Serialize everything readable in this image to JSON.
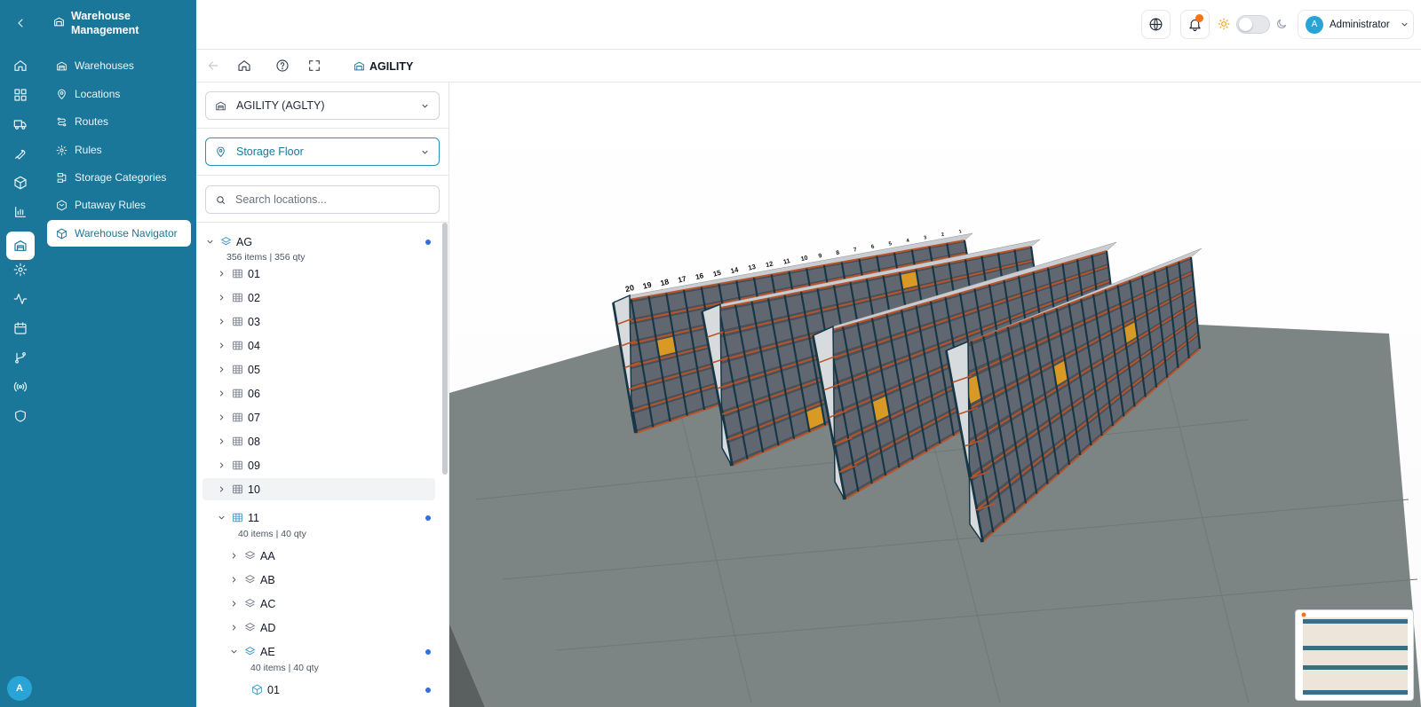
{
  "app": {
    "title": "Warehouse Management",
    "avatar_initial": "A"
  },
  "rail": {
    "items": [
      "home-icon",
      "dashboard-icon",
      "truck-icon",
      "wrench-icon",
      "box-icon",
      "chart-icon",
      "warehouse-icon",
      "settings-icon",
      "activity-icon",
      "calendar-icon",
      "git-branch-icon",
      "broadcast-icon",
      "shield-icon"
    ],
    "active": "warehouse-icon"
  },
  "sidebar": {
    "items": [
      {
        "label": "Warehouses",
        "icon": "warehouse-icon"
      },
      {
        "label": "Locations",
        "icon": "map-pin-icon"
      },
      {
        "label": "Routes",
        "icon": "route-icon"
      },
      {
        "label": "Rules",
        "icon": "gear-icon"
      },
      {
        "label": "Storage Categories",
        "icon": "stack-icon"
      },
      {
        "label": "Putaway Rules",
        "icon": "box-in-icon"
      },
      {
        "label": "Warehouse Navigator",
        "icon": "cube-icon",
        "active": true
      }
    ]
  },
  "header": {
    "user_name": "Administrator",
    "user_initial": "A",
    "theme_toggle_on": false,
    "has_notification": true
  },
  "toolbar": {
    "tab_label": "AGILITY"
  },
  "panel": {
    "warehouse_select": "AGILITY (AGLTY)",
    "location_select": "Storage Floor",
    "search_placeholder": "Search locations...",
    "search_value": ""
  },
  "tree": {
    "root": {
      "label": "AG",
      "summary": "356 items | 356 qty"
    },
    "aisles": [
      "01",
      "02",
      "03",
      "04",
      "05",
      "06",
      "07",
      "08",
      "09",
      "10"
    ],
    "expanded_aisle": {
      "label": "11",
      "summary": "40 items | 40 qty"
    },
    "racks": [
      "AA",
      "AB",
      "AC",
      "AD"
    ],
    "expanded_rack": {
      "label": "AE",
      "summary": "40 items | 40 qty"
    },
    "bin": {
      "label": "01"
    }
  },
  "viewport": {
    "floor_color": "#7c8584",
    "rack_frame_color": "#173646",
    "rack_beam_color": "#b7542a",
    "box_gray_color": "#606770",
    "box_amber_color": "#d89a24",
    "rack_labels": [
      "20",
      "19",
      "18",
      "17",
      "16",
      "15",
      "14",
      "13",
      "12",
      "11",
      "10",
      "9",
      "8",
      "7",
      "6",
      "5",
      "4",
      "3",
      "2",
      "1"
    ]
  }
}
